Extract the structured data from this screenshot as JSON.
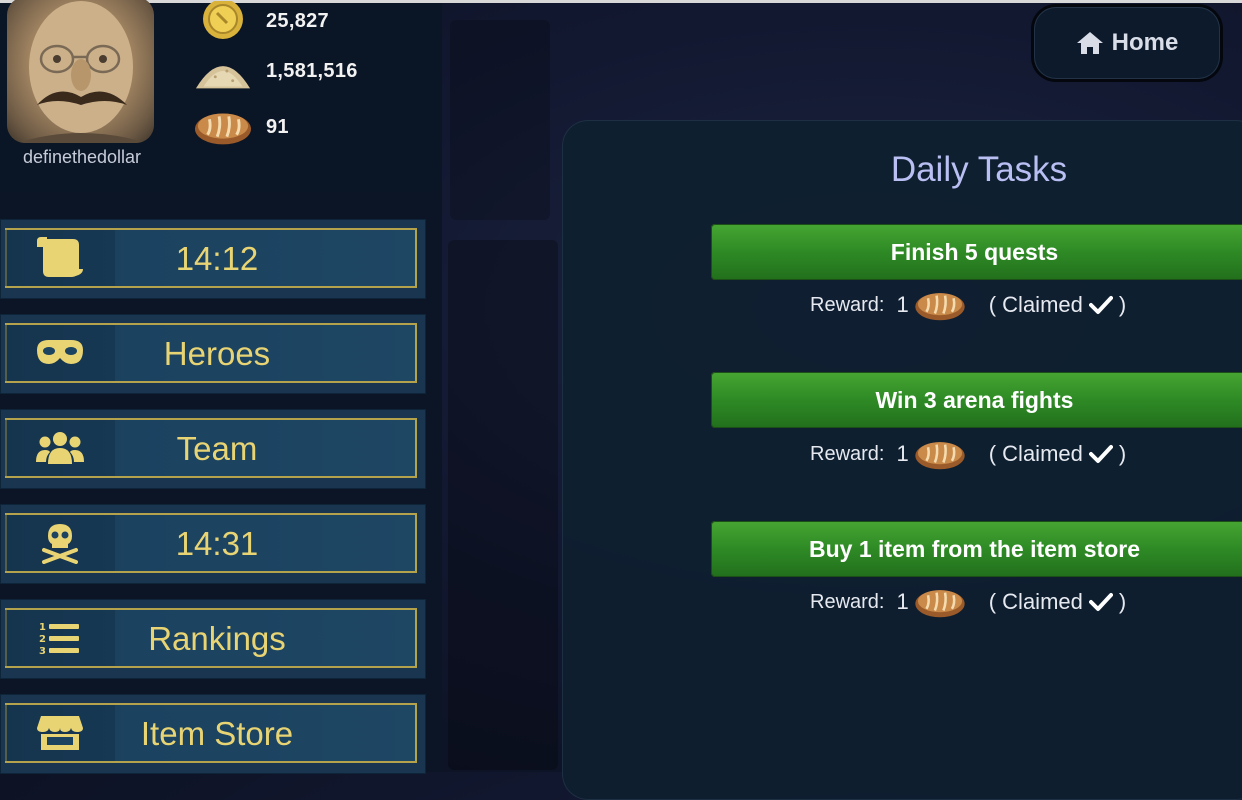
{
  "profile": {
    "username": "definethedollar",
    "resources": {
      "gold": {
        "value": "25,827",
        "icon": "gold-coin-icon"
      },
      "flour": {
        "value": "1,581,516",
        "icon": "flour-pile-icon"
      },
      "bread": {
        "value": "91",
        "icon": "bread-icon"
      }
    }
  },
  "menu": {
    "items": [
      {
        "label": "14:12",
        "icon": "scroll-icon"
      },
      {
        "label": "Heroes",
        "icon": "mask-icon"
      },
      {
        "label": "Team",
        "icon": "team-icon"
      },
      {
        "label": "14:31",
        "icon": "skull-crossbones-icon"
      },
      {
        "label": "Rankings",
        "icon": "ranked-list-icon"
      },
      {
        "label": "Item Store",
        "icon": "store-icon"
      }
    ]
  },
  "header": {
    "home_label": "Home",
    "home_icon": "home-icon"
  },
  "daily_tasks": {
    "title": "Daily Tasks",
    "tasks": [
      {
        "name": "Finish 5 quests",
        "reward_label": "Reward:",
        "reward_count": "1",
        "status_open": "( Claimed",
        "status_close": ")"
      },
      {
        "name": "Win 3 arena fights",
        "reward_label": "Reward:",
        "reward_count": "1",
        "status_open": "( Claimed",
        "status_close": ")"
      },
      {
        "name": "Buy 1 item from the item store",
        "reward_label": "Reward:",
        "reward_count": "1",
        "status_open": "( Claimed",
        "status_close": ")"
      }
    ]
  },
  "colors": {
    "menu_text": "#e9d474",
    "menu_border": "#b4a34c",
    "task_green": "#2e8a25",
    "title_lavender": "#b9bff2"
  }
}
